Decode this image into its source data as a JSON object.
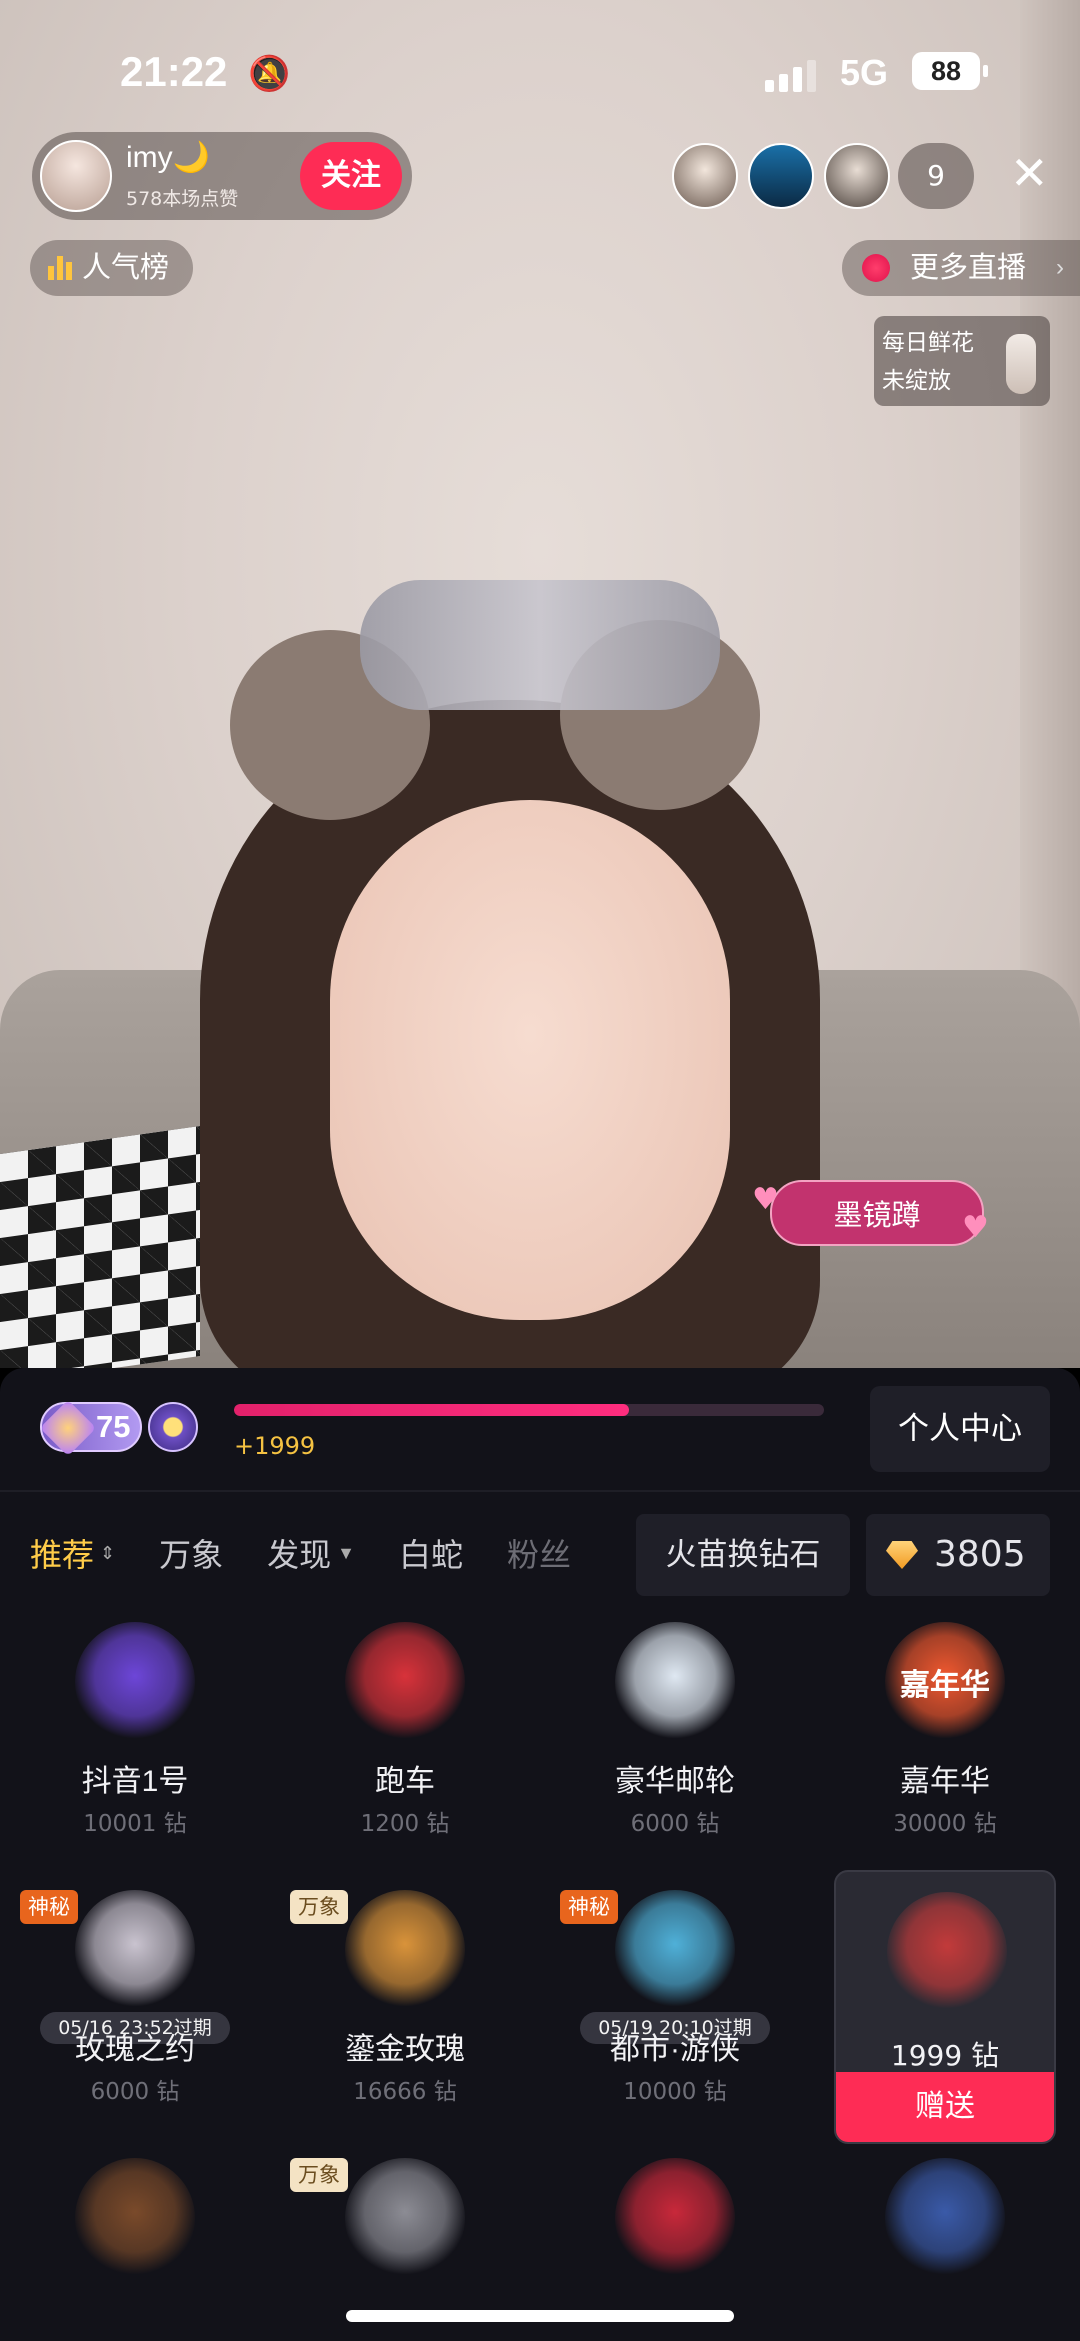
{
  "status_bar": {
    "time": "21:22",
    "network": "5G",
    "battery": "88"
  },
  "host": {
    "name": "imy🌙",
    "likes": "578本场点赞",
    "follow_label": "关注"
  },
  "audience": {
    "count": "9"
  },
  "top_controls": {
    "popularity_label": "人气榜",
    "more_live_label": "更多直播",
    "flower_line1": "每日鲜花",
    "flower_line2": "未绽放"
  },
  "video": {
    "name_tag": "墨镜蹲"
  },
  "level": {
    "number": "75",
    "progress": 0.67,
    "gain": "+1999",
    "center_label": "个人中心"
  },
  "tabs": [
    {
      "label": "推荐",
      "active": true
    },
    {
      "label": "万象"
    },
    {
      "label": "发现"
    },
    {
      "label": "白蛇"
    },
    {
      "label": "粉丝"
    }
  ],
  "wallet": {
    "exchange_label": "火苗换钻石",
    "balance": "3805"
  },
  "gifts": [
    {
      "name": "抖音1号",
      "price": "10001 钻",
      "icon": "rocket-icon",
      "color": "#6d46d8"
    },
    {
      "name": "跑车",
      "price": "1200 钻",
      "icon": "sports-car-icon",
      "color": "#d8323a"
    },
    {
      "name": "豪华邮轮",
      "price": "6000 钻",
      "icon": "cruise-ship-icon",
      "color": "#dfe8f2"
    },
    {
      "name": "嘉年华",
      "price": "30000 钻",
      "icon": "carnival-icon",
      "color": "#f0582f",
      "art_text": "嘉年华"
    },
    {
      "name": "玫瑰之约",
      "price": "6000 钻",
      "icon": "rose-knight-icon",
      "color": "#c9c3cf",
      "badge": "神秘",
      "expire": "05/16 23:52过期"
    },
    {
      "name": "鎏金玫瑰",
      "price": "16666 钻",
      "icon": "golden-rose-icon",
      "color": "#d9933a",
      "badge": "万象"
    },
    {
      "name": "都市·游侠",
      "price": "10000 钻",
      "icon": "city-ranger-icon",
      "color": "#4fb0d8",
      "badge": "神秘",
      "expire": "05/19 20:10过期"
    },
    {
      "name": "",
      "price": "1999 钻",
      "icon": "bicycle-icon",
      "color": "#c23a3a",
      "send_label": "赠送",
      "selected": true
    },
    {
      "name": "",
      "price": "",
      "icon": "astronaut-icon",
      "color": "#7a4a2a"
    },
    {
      "name": "",
      "price": "",
      "icon": "eagle-icon",
      "color": "#8c8c94",
      "badge": "万象"
    },
    {
      "name": "",
      "price": "",
      "icon": "red-envelope-icon",
      "color": "#c8283a"
    },
    {
      "name": "",
      "price": "",
      "icon": "hot-air-balloon-icon",
      "color": "#3a5aa8"
    }
  ]
}
